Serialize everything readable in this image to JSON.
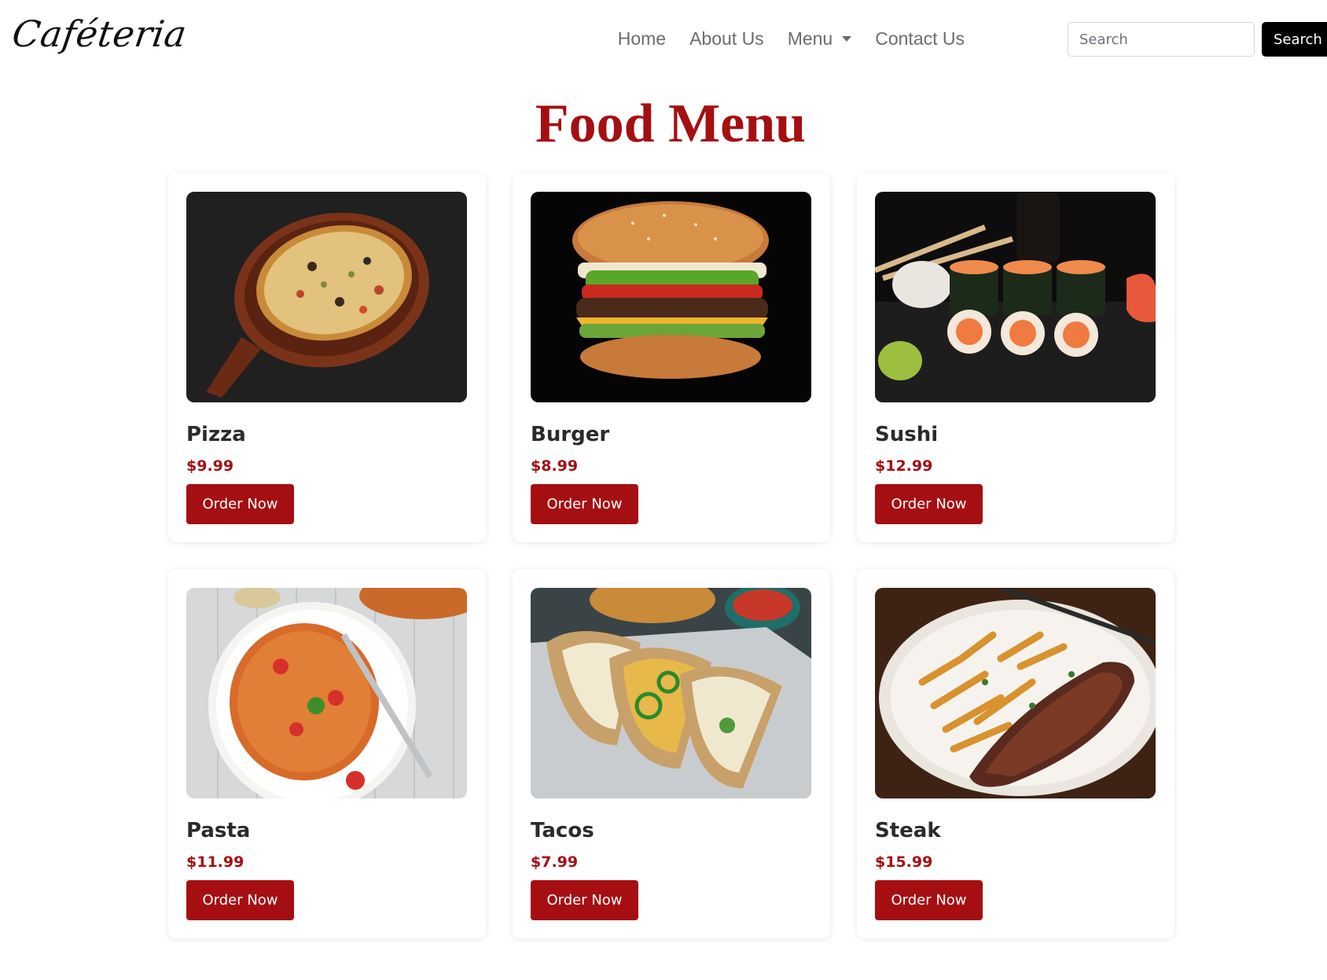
{
  "navbar": {
    "brand": "Caféteria",
    "links": {
      "home": "Home",
      "about": "About Us",
      "menu": "Menu",
      "contact": "Contact Us"
    },
    "search": {
      "placeholder": "Search",
      "button_label": "Search"
    }
  },
  "page": {
    "title": "Food Menu"
  },
  "items": [
    {
      "name": "Pizza",
      "price": "$9.99",
      "button": "Order Now"
    },
    {
      "name": "Burger",
      "price": "$8.99",
      "button": "Order Now"
    },
    {
      "name": "Sushi",
      "price": "$12.99",
      "button": "Order Now"
    },
    {
      "name": "Pasta",
      "price": "$11.99",
      "button": "Order Now"
    },
    {
      "name": "Tacos",
      "price": "$7.99",
      "button": "Order Now"
    },
    {
      "name": "Steak",
      "price": "$15.99",
      "button": "Order Now"
    }
  ],
  "colors": {
    "accent": "#a50f12",
    "nav_text": "#6c6c6c",
    "search_button": "#000000"
  }
}
